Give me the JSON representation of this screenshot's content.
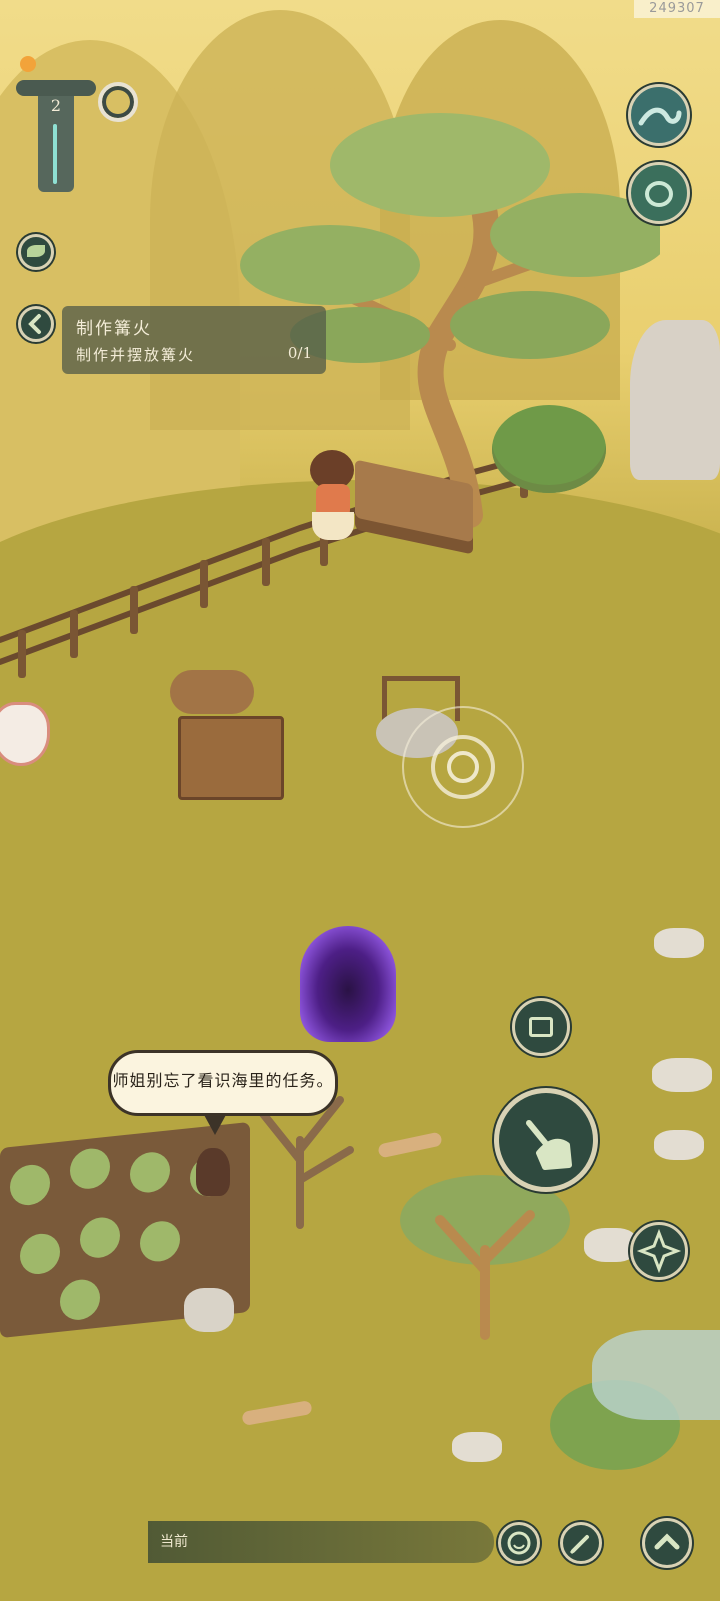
{
  "build_id": "249307",
  "hud": {
    "level": "2",
    "quest": {
      "title": "制作篝火",
      "subtitle": "制作并摆放篝火",
      "progress": "0/1"
    }
  },
  "npc_dialog": "师姐别忘了看识海里的任务。",
  "chat": {
    "channel": "当前"
  },
  "colors": {
    "accent_dark": "#2f4a3f",
    "ring_light": "#d9d2b4",
    "portal": "#8a52d8"
  },
  "icons": {
    "wave": "wave-icon",
    "pot": "pot-icon",
    "leaf": "leaf-icon",
    "back": "chevron-left-icon",
    "hand": "hand-icon",
    "craft": "crafting-box-icon",
    "shuriken": "shuriken-icon",
    "emote": "smile-icon",
    "edit": "pencil-icon",
    "up": "chevron-up-icon",
    "ring": "ring-icon"
  }
}
